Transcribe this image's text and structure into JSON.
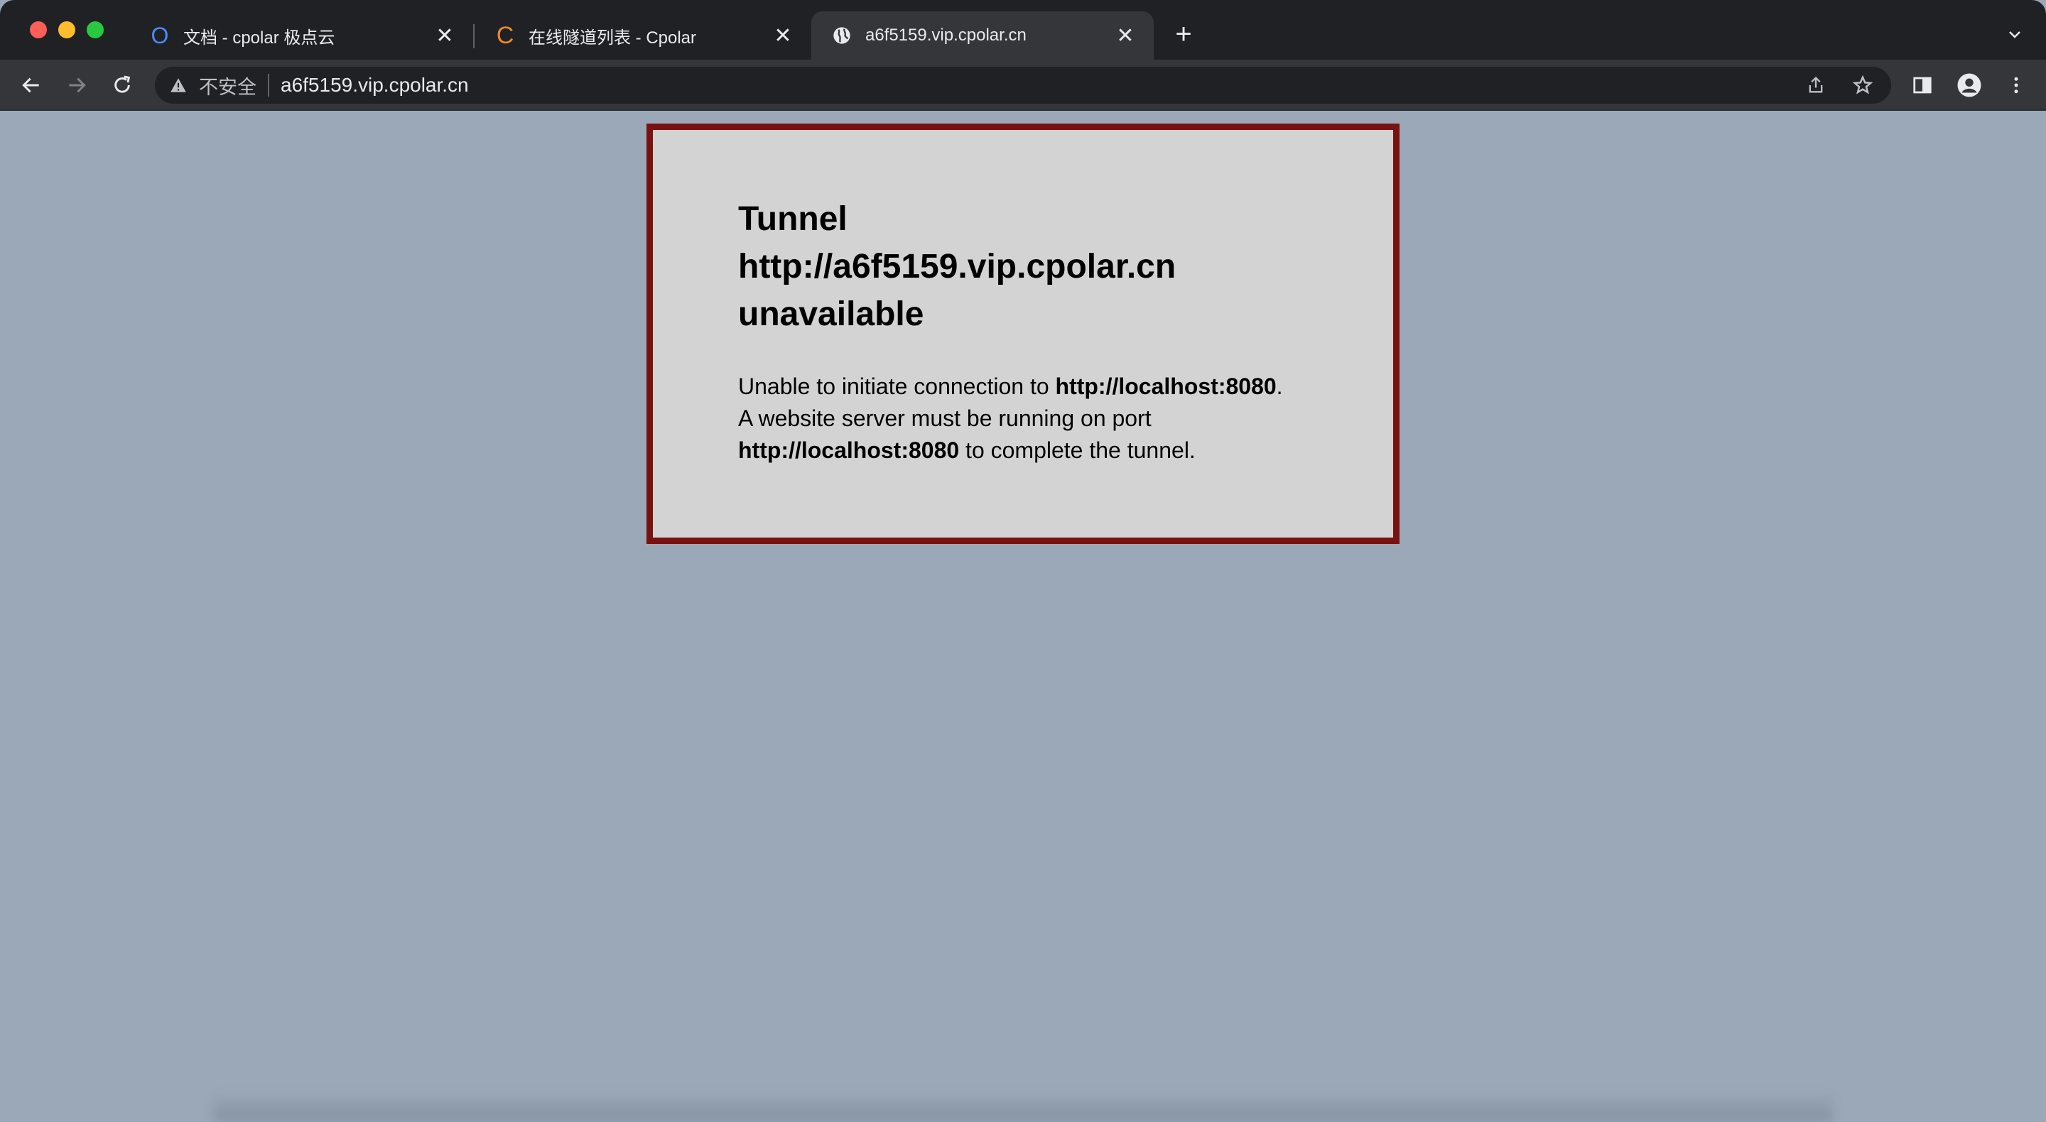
{
  "browser": {
    "tabs": [
      {
        "title": "文档 - cpolar 极点云",
        "favicon": "cpolar-docs-icon",
        "active": false
      },
      {
        "title": "在线隧道列表 - Cpolar",
        "favicon": "cpolar-c-icon",
        "active": false
      },
      {
        "title": "a6f5159.vip.cpolar.cn",
        "favicon": "globe-icon",
        "active": true
      }
    ],
    "omnibox": {
      "security_label": "不安全",
      "url": "a6f5159.vip.cpolar.cn"
    },
    "colors": {
      "tabstrip": "#202124",
      "toolbar": "#35363a",
      "page_background": "#9aa8b8",
      "error_border": "#7a1111",
      "error_background": "#d3d3d3"
    }
  },
  "page": {
    "title_line1": "Tunnel",
    "title_line2": "http://a6f5159.vip.cpolar.cn",
    "title_line3": "unavailable",
    "msg_part1": "Unable to initiate connection to ",
    "msg_bold1": "http://localhost:8080",
    "msg_part2": ". A website server must be running on port ",
    "msg_bold2": "http://localhost:8080",
    "msg_part3": " to complete the tunnel."
  }
}
